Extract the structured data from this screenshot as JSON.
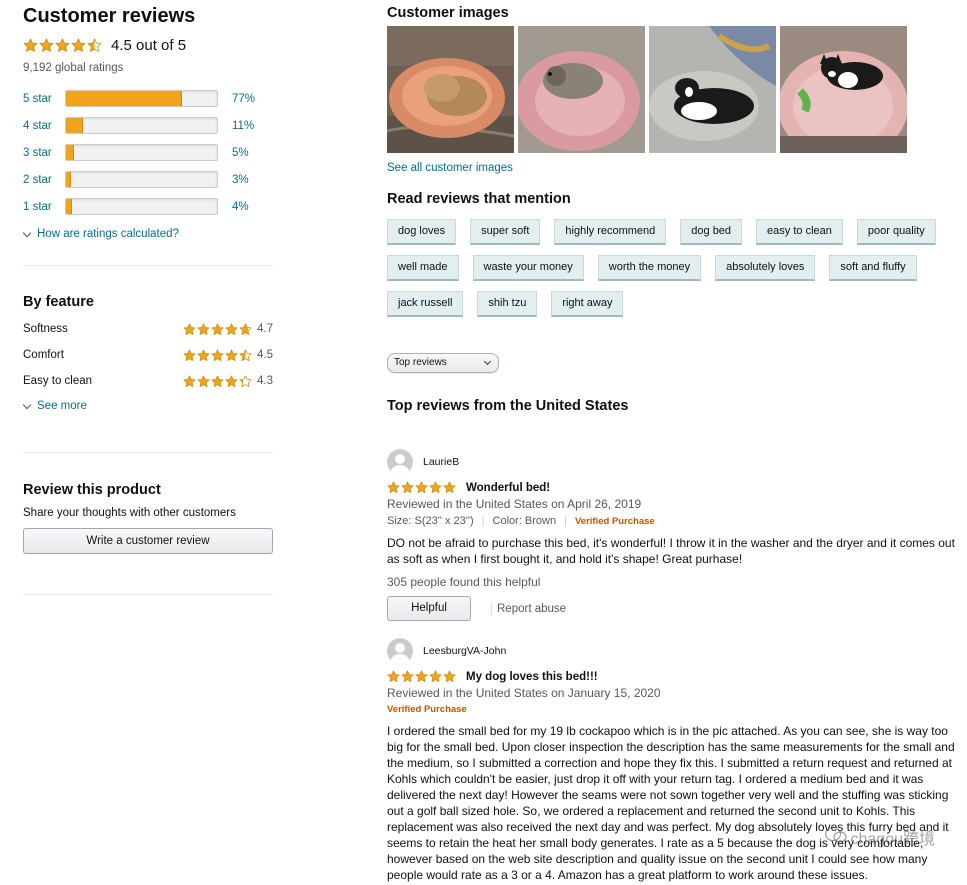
{
  "left": {
    "title": "Customer reviews",
    "summary": {
      "rating": 4.5,
      "text": "4.5 out of 5"
    },
    "global_ratings": "9,192 global ratings",
    "histogram": [
      {
        "label": "5 star",
        "pct": "77%",
        "fraction": 0.77
      },
      {
        "label": "4 star",
        "pct": "11%",
        "fraction": 0.11
      },
      {
        "label": "3 star",
        "pct": "5%",
        "fraction": 0.05
      },
      {
        "label": "2 star",
        "pct": "3%",
        "fraction": 0.03
      },
      {
        "label": "1 star",
        "pct": "4%",
        "fraction": 0.04
      }
    ],
    "how_calculated": "How are ratings calculated?",
    "by_feature": {
      "title": "By feature",
      "items": [
        {
          "name": "Softness",
          "score": "4.7",
          "rating": 4.7
        },
        {
          "name": "Comfort",
          "score": "4.5",
          "rating": 4.5
        },
        {
          "name": "Easy to clean",
          "score": "4.3",
          "rating": 4.3
        }
      ],
      "see_more": "See more"
    },
    "review_product": {
      "title": "Review this product",
      "subtitle": "Share your thoughts with other customers",
      "button": "Write a customer review"
    }
  },
  "right": {
    "images_title": "Customer images",
    "see_all_images": "See all customer images",
    "mentions_title": "Read reviews that mention",
    "tags": [
      "dog loves",
      "super soft",
      "highly recommend",
      "dog bed",
      "easy to clean",
      "poor quality",
      "well made",
      "waste your money",
      "worth the money",
      "absolutely loves",
      "soft and fluffy",
      "jack russell",
      "shih tzu",
      "right away"
    ],
    "sort_select": "Top reviews",
    "top_reviews_title": "Top reviews from the United States",
    "reviews": [
      {
        "name": "LaurieB",
        "rating": 5,
        "title": "Wonderful bed!",
        "date": "Reviewed in the United States on April 26, 2019",
        "size": "Size: S(23'' x 23'')",
        "color": "Color: Brown",
        "verified": "Verified Purchase",
        "body": "DO not be afraid to purchase this bed, it's wonderful! I throw it in the washer and the dryer and it comes out as soft as when I first bought it, and hold it's shape! Great purhase!",
        "helpful": "305 people found this helpful",
        "helpful_btn": "Helpful",
        "report": "Report abuse"
      },
      {
        "name": "LeesburgVA-John",
        "rating": 5,
        "title": "My dog loves this bed!!!",
        "date": "Reviewed in the United States on January 15, 2020",
        "verified": "Verified Purchase",
        "body": "I ordered the small bed for my 19 lb cockapoo which is in the pic attached. As you can see, she is way too big for the small bed. Upon closer inspection the description has the same measurements for the small and the medium, so I submitted a correction and hope they fix this. I submitted a return request and returned at Kohls which couldn't be easier, just drop it off with your return tag. I ordered a medium bed and it was delivered the next day! However the seams were not sown together very well and the stuffing was sticking out a golf ball sized hole. So, we ordered a replacement and returned the second unit to Kohls. This replacement was also received the next day and was perfect. My dog absolutely loves this furry bed and it seems to retain the heat her small body generates. I rate as a 5 because the dog is very comfortable, however based on the web site description and quality issue on the second unit I could see how many people would rate as a 3 or a 4. Amazon has a great platform to work around these issues."
      }
    ]
  },
  "watermark": "chagou跨境",
  "colors": {
    "star": "#f0a31c",
    "link": "#007185",
    "verified": "#c45500",
    "tag_bg": "#e3eef0"
  }
}
